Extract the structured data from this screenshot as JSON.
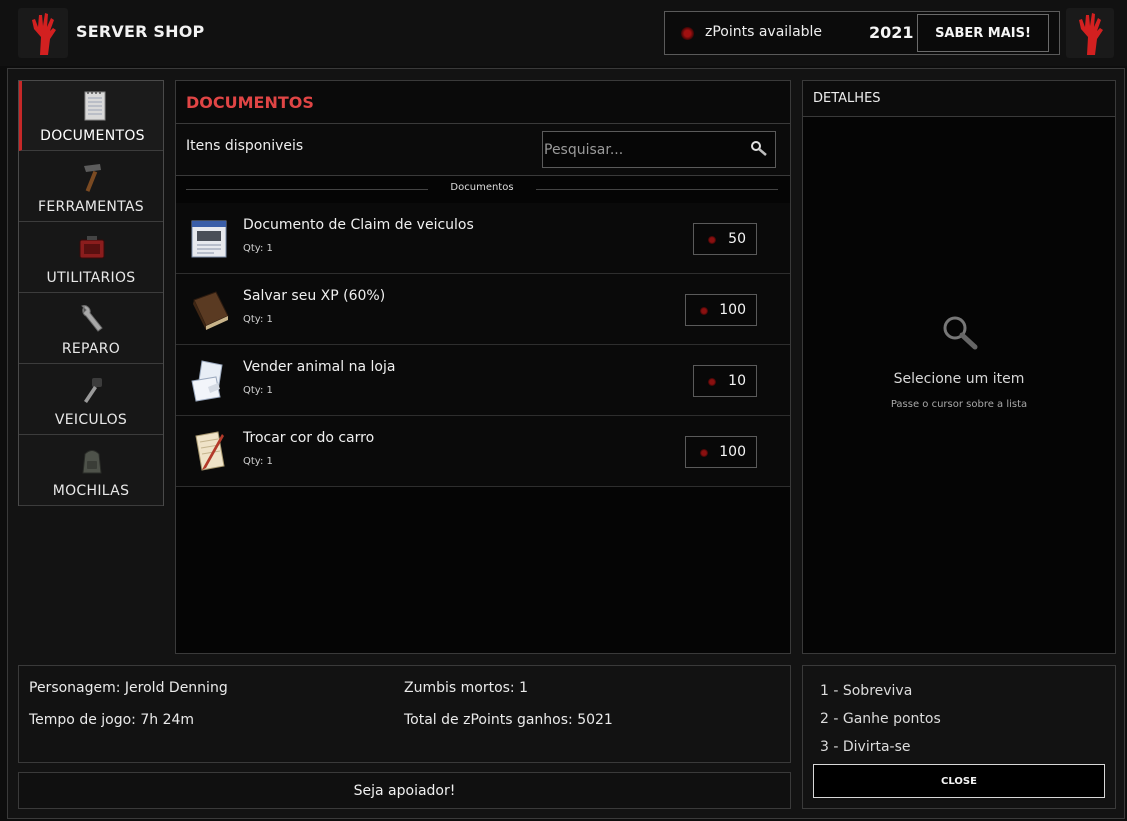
{
  "header": {
    "title": "SERVER SHOP",
    "points_label": "zPoints available",
    "points_value": "2021",
    "learn_more_label": "SABER MAIS!"
  },
  "sidebar": {
    "items": [
      {
        "label": "DOCUMENTOS",
        "icon": "notebook-icon",
        "active": true
      },
      {
        "label": "FERRAMENTAS",
        "icon": "hammer-icon",
        "active": false
      },
      {
        "label": "UTILITARIOS",
        "icon": "generator-icon",
        "active": false
      },
      {
        "label": "REPARO",
        "icon": "wrench-icon",
        "active": false
      },
      {
        "label": "VEICULOS",
        "icon": "car-key-icon",
        "active": false
      },
      {
        "label": "MOCHILAS",
        "icon": "backpack-icon",
        "active": false
      }
    ]
  },
  "catalog": {
    "title": "DOCUMENTOS",
    "available_label": "Itens disponiveis",
    "search_placeholder": "Pesquisar...",
    "section_label": "Documentos",
    "items": [
      {
        "name": "Documento de Claim de veiculos",
        "qty": "Qty: 1",
        "price": "50",
        "icon": "vehicle-document-icon"
      },
      {
        "name": "Salvar seu XP (60%)",
        "qty": "Qty: 1",
        "price": "100",
        "icon": "book-icon"
      },
      {
        "name": "Vender animal na loja",
        "qty": "Qty: 1",
        "price": "10",
        "icon": "paper-sheets-icon"
      },
      {
        "name": "Trocar cor do carro",
        "qty": "Qty: 1",
        "price": "100",
        "icon": "note-pencil-icon"
      }
    ]
  },
  "details": {
    "title": "DETALHES",
    "empty_title": "Selecione um item",
    "empty_hint": "Passe o cursor sobre a lista"
  },
  "stats": {
    "character": "Personagem: Jerold Denning",
    "playtime": "Tempo de jogo: 7h 24m",
    "zombies": "Zumbis mortos: 1",
    "total_points": "Total de zPoints ganhos: 5021",
    "support_label": "Seja apoiador!"
  },
  "tips": {
    "lines": [
      "1 - Sobreviva",
      "2 - Ganhe pontos",
      "3 - Divirta-se"
    ],
    "close_label": "CLOSE"
  },
  "colors": {
    "accent_red": "#e04545",
    "active_border": "#c62828",
    "background": "#0d0d0d"
  }
}
